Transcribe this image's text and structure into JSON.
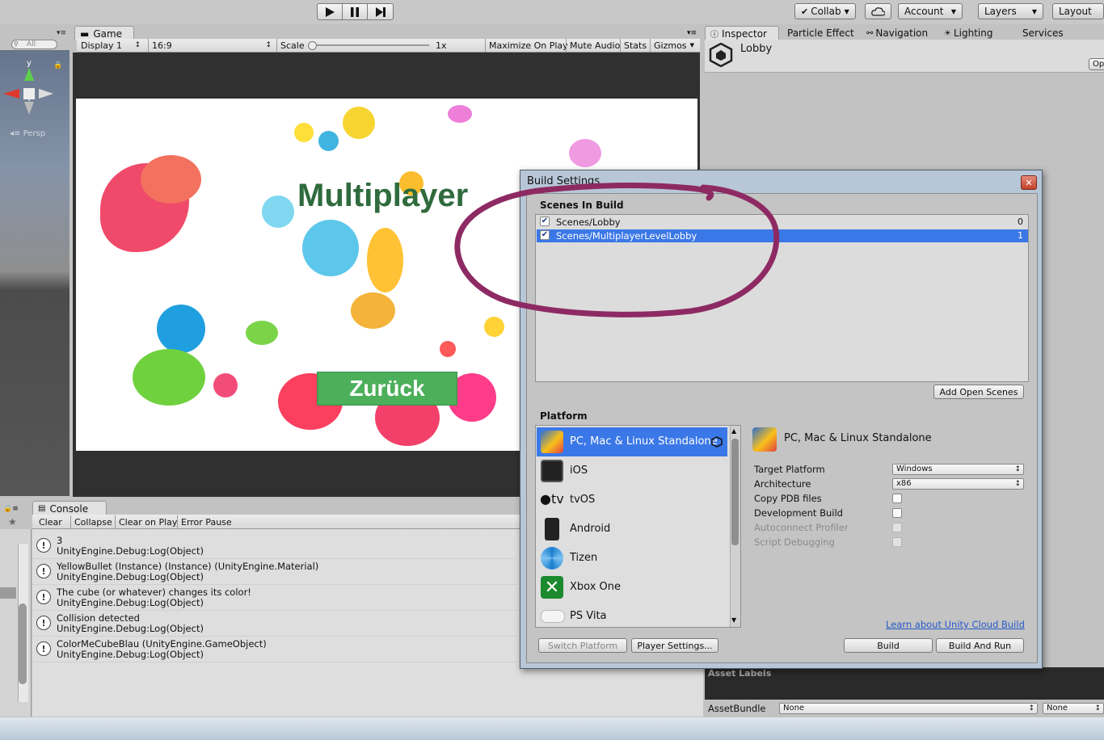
{
  "toolbar": {
    "collab": "Collab",
    "account": "Account",
    "layers": "Layers",
    "layout": "Layout"
  },
  "hierarchy": {
    "search_placeholder": "All",
    "persp": "Persp"
  },
  "game": {
    "tab": "Game",
    "display": "Display 1",
    "aspect": "16:9",
    "scale_label": "Scale",
    "scale_value": "1x",
    "maximize": "Maximize On Play",
    "mute": "Mute Audio",
    "stats": "Stats",
    "gizmos": "Gizmos",
    "title_text": "Multiplayer",
    "back_button": "Zurück"
  },
  "inspector": {
    "tabs": [
      "Inspector",
      "Particle Effect",
      "Navigation",
      "Lighting",
      "Services"
    ],
    "object": "Lobby",
    "open_btn": "Op",
    "asset_labels": "Asset Labels",
    "asset_bundle": "AssetBundle",
    "none1": "None",
    "none2": "None"
  },
  "console": {
    "tab": "Console",
    "buttons": [
      "Clear",
      "Collapse",
      "Clear on Play",
      "Error Pause"
    ],
    "rows": [
      {
        "line1": "3",
        "line2": "UnityEngine.Debug:Log(Object)"
      },
      {
        "line1": "YellowBullet (Instance) (Instance) (UnityEngine.Material)",
        "line2": "UnityEngine.Debug:Log(Object)"
      },
      {
        "line1": "The cube (or whatever) changes its color!",
        "line2": "UnityEngine.Debug:Log(Object)"
      },
      {
        "line1": "Collision detected",
        "line2": "UnityEngine.Debug:Log(Object)"
      },
      {
        "line1": "ColorMeCubeBlau (UnityEngine.GameObject)",
        "line2": "UnityEngine.Debug:Log(Object)"
      }
    ]
  },
  "build": {
    "title": "Build Settings",
    "close": "✕",
    "scenes_header": "Scenes In Build",
    "scenes": [
      {
        "name": "Scenes/Lobby",
        "index": "0"
      },
      {
        "name": "Scenes/MultiplayerLevelLobby",
        "index": "1"
      }
    ],
    "add_open_scenes": "Add Open Scenes",
    "platform_header": "Platform",
    "platforms": [
      "PC, Mac & Linux Standalone",
      "iOS",
      "tvOS",
      "Android",
      "Tizen",
      "Xbox One",
      "PS Vita"
    ],
    "tv_glyph": "tv",
    "selected_platform": "PC, Mac & Linux Standalone",
    "settings": {
      "target_platform_label": "Target Platform",
      "target_platform_value": "Windows",
      "architecture_label": "Architecture",
      "architecture_value": "x86",
      "copy_pdb": "Copy PDB files",
      "dev_build": "Development Build",
      "autoconnect": "Autoconnect Profiler",
      "script_debugging": "Script Debugging"
    },
    "cloud_link": "Learn about Unity Cloud Build",
    "switch_platform": "Switch Platform",
    "player_settings": "Player Settings...",
    "build_btn": "Build",
    "build_and_run": "Build And Run"
  },
  "colors": {
    "selection": "#3b78e7",
    "annotation": "#8e2a63",
    "zurueck": "#4caf5a"
  }
}
